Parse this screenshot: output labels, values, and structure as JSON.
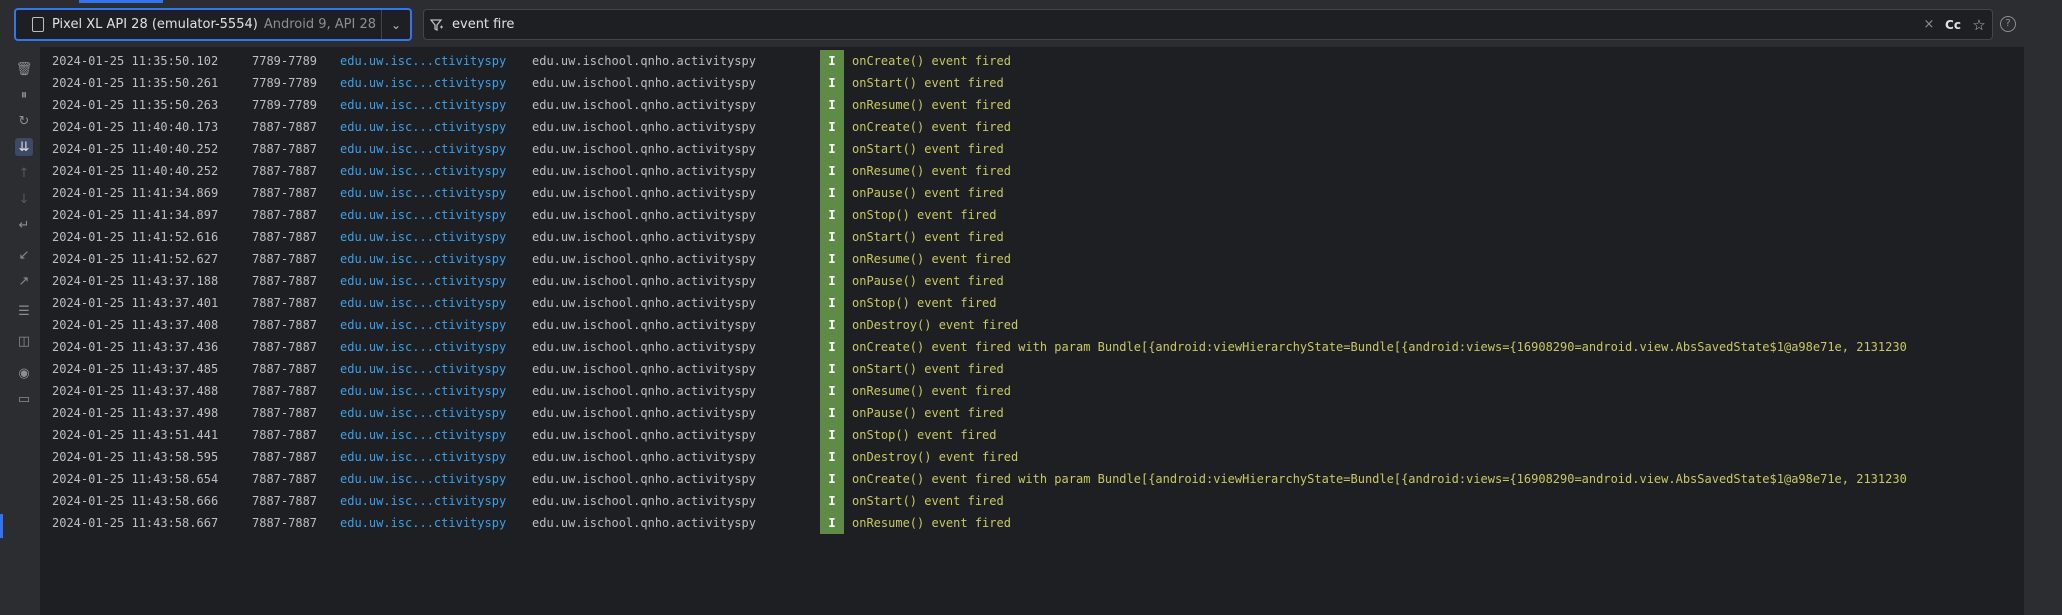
{
  "device": {
    "name": "Pixel XL API 28 (emulator-5554)",
    "subtitle": "Android 9, API 28"
  },
  "filter": {
    "query": "event fire",
    "case_label": "Cc"
  },
  "icons": {
    "device": "phone-icon",
    "dropdown": "chevron-down-icon",
    "filter": "filter-icon",
    "clear": "close-icon",
    "favorite": "star-icon",
    "help": "help-icon"
  },
  "toolbar": [
    {
      "name": "clear-logcat-button",
      "icon": "trash-icon",
      "glyph": "🗑"
    },
    {
      "name": "pause-button",
      "icon": "pause-icon",
      "glyph": "⏸"
    },
    {
      "name": "restart-button",
      "icon": "restart-icon",
      "glyph": "↻"
    },
    {
      "name": "scroll-to-end-button",
      "icon": "scroll-end-icon",
      "glyph": "⇊"
    },
    {
      "name": "previous-occurrence-button",
      "icon": "arrow-up-icon",
      "glyph": "↑"
    },
    {
      "name": "next-occurrence-button",
      "icon": "arrow-down-icon",
      "glyph": "↓"
    },
    {
      "name": "soft-wrap-button",
      "icon": "wrap-icon",
      "glyph": "↵"
    },
    {
      "name": "import-button",
      "icon": "import-icon",
      "glyph": "↙"
    },
    {
      "name": "export-button",
      "icon": "export-icon",
      "glyph": "↗"
    },
    {
      "name": "format-button",
      "icon": "settings-icon",
      "glyph": "☰"
    },
    {
      "name": "split-panels-button",
      "icon": "split-icon",
      "glyph": "◫"
    },
    {
      "name": "screenshot-button",
      "icon": "camera-icon",
      "glyph": "◉"
    },
    {
      "name": "screen-record-button",
      "icon": "video-icon",
      "glyph": "▭"
    }
  ],
  "colors": {
    "accent": "#3574f0",
    "tag": "#3d9fe8",
    "level_info_bg": "#5e8b45",
    "message": "#c8c864"
  },
  "log_rows": [
    {
      "time": "2024-01-25 11:35:50.102",
      "pid": "7789-7789",
      "tag": "edu.uw.isc...ctivityspy",
      "pkg": "edu.uw.ischool.qnho.activityspy",
      "level": "I",
      "msg": "onCreate() event fired"
    },
    {
      "time": "2024-01-25 11:35:50.261",
      "pid": "7789-7789",
      "tag": "edu.uw.isc...ctivityspy",
      "pkg": "edu.uw.ischool.qnho.activityspy",
      "level": "I",
      "msg": "onStart() event fired"
    },
    {
      "time": "2024-01-25 11:35:50.263",
      "pid": "7789-7789",
      "tag": "edu.uw.isc...ctivityspy",
      "pkg": "edu.uw.ischool.qnho.activityspy",
      "level": "I",
      "msg": "onResume() event fired"
    },
    {
      "time": "2024-01-25 11:40:40.173",
      "pid": "7887-7887",
      "tag": "edu.uw.isc...ctivityspy",
      "pkg": "edu.uw.ischool.qnho.activityspy",
      "level": "I",
      "msg": "onCreate() event fired"
    },
    {
      "time": "2024-01-25 11:40:40.252",
      "pid": "7887-7887",
      "tag": "edu.uw.isc...ctivityspy",
      "pkg": "edu.uw.ischool.qnho.activityspy",
      "level": "I",
      "msg": "onStart() event fired"
    },
    {
      "time": "2024-01-25 11:40:40.252",
      "pid": "7887-7887",
      "tag": "edu.uw.isc...ctivityspy",
      "pkg": "edu.uw.ischool.qnho.activityspy",
      "level": "I",
      "msg": "onResume() event fired"
    },
    {
      "time": "2024-01-25 11:41:34.869",
      "pid": "7887-7887",
      "tag": "edu.uw.isc...ctivityspy",
      "pkg": "edu.uw.ischool.qnho.activityspy",
      "level": "I",
      "msg": "onPause() event fired"
    },
    {
      "time": "2024-01-25 11:41:34.897",
      "pid": "7887-7887",
      "tag": "edu.uw.isc...ctivityspy",
      "pkg": "edu.uw.ischool.qnho.activityspy",
      "level": "I",
      "msg": "onStop() event fired"
    },
    {
      "time": "2024-01-25 11:41:52.616",
      "pid": "7887-7887",
      "tag": "edu.uw.isc...ctivityspy",
      "pkg": "edu.uw.ischool.qnho.activityspy",
      "level": "I",
      "msg": "onStart() event fired"
    },
    {
      "time": "2024-01-25 11:41:52.627",
      "pid": "7887-7887",
      "tag": "edu.uw.isc...ctivityspy",
      "pkg": "edu.uw.ischool.qnho.activityspy",
      "level": "I",
      "msg": "onResume() event fired"
    },
    {
      "time": "2024-01-25 11:43:37.188",
      "pid": "7887-7887",
      "tag": "edu.uw.isc...ctivityspy",
      "pkg": "edu.uw.ischool.qnho.activityspy",
      "level": "I",
      "msg": "onPause() event fired"
    },
    {
      "time": "2024-01-25 11:43:37.401",
      "pid": "7887-7887",
      "tag": "edu.uw.isc...ctivityspy",
      "pkg": "edu.uw.ischool.qnho.activityspy",
      "level": "I",
      "msg": "onStop() event fired"
    },
    {
      "time": "2024-01-25 11:43:37.408",
      "pid": "7887-7887",
      "tag": "edu.uw.isc...ctivityspy",
      "pkg": "edu.uw.ischool.qnho.activityspy",
      "level": "I",
      "msg": "onDestroy() event fired"
    },
    {
      "time": "2024-01-25 11:43:37.436",
      "pid": "7887-7887",
      "tag": "edu.uw.isc...ctivityspy",
      "pkg": "edu.uw.ischool.qnho.activityspy",
      "level": "I",
      "msg": "onCreate() event fired with param Bundle[{android:viewHierarchyState=Bundle[{android:views={16908290=android.view.AbsSavedState$1@a98e71e, 2131230"
    },
    {
      "time": "2024-01-25 11:43:37.485",
      "pid": "7887-7887",
      "tag": "edu.uw.isc...ctivityspy",
      "pkg": "edu.uw.ischool.qnho.activityspy",
      "level": "I",
      "msg": "onStart() event fired"
    },
    {
      "time": "2024-01-25 11:43:37.488",
      "pid": "7887-7887",
      "tag": "edu.uw.isc...ctivityspy",
      "pkg": "edu.uw.ischool.qnho.activityspy",
      "level": "I",
      "msg": "onResume() event fired"
    },
    {
      "time": "2024-01-25 11:43:37.498",
      "pid": "7887-7887",
      "tag": "edu.uw.isc...ctivityspy",
      "pkg": "edu.uw.ischool.qnho.activityspy",
      "level": "I",
      "msg": "onPause() event fired"
    },
    {
      "time": "2024-01-25 11:43:51.441",
      "pid": "7887-7887",
      "tag": "edu.uw.isc...ctivityspy",
      "pkg": "edu.uw.ischool.qnho.activityspy",
      "level": "I",
      "msg": "onStop() event fired"
    },
    {
      "time": "2024-01-25 11:43:58.595",
      "pid": "7887-7887",
      "tag": "edu.uw.isc...ctivityspy",
      "pkg": "edu.uw.ischool.qnho.activityspy",
      "level": "I",
      "msg": "onDestroy() event fired"
    },
    {
      "time": "2024-01-25 11:43:58.654",
      "pid": "7887-7887",
      "tag": "edu.uw.isc...ctivityspy",
      "pkg": "edu.uw.ischool.qnho.activityspy",
      "level": "I",
      "msg": "onCreate() event fired with param Bundle[{android:viewHierarchyState=Bundle[{android:views={16908290=android.view.AbsSavedState$1@a98e71e, 2131230"
    },
    {
      "time": "2024-01-25 11:43:58.666",
      "pid": "7887-7887",
      "tag": "edu.uw.isc...ctivityspy",
      "pkg": "edu.uw.ischool.qnho.activityspy",
      "level": "I",
      "msg": "onStart() event fired"
    },
    {
      "time": "2024-01-25 11:43:58.667",
      "pid": "7887-7887",
      "tag": "edu.uw.isc...ctivityspy",
      "pkg": "edu.uw.ischool.qnho.activityspy",
      "level": "I",
      "msg": "onResume() event fired"
    }
  ]
}
